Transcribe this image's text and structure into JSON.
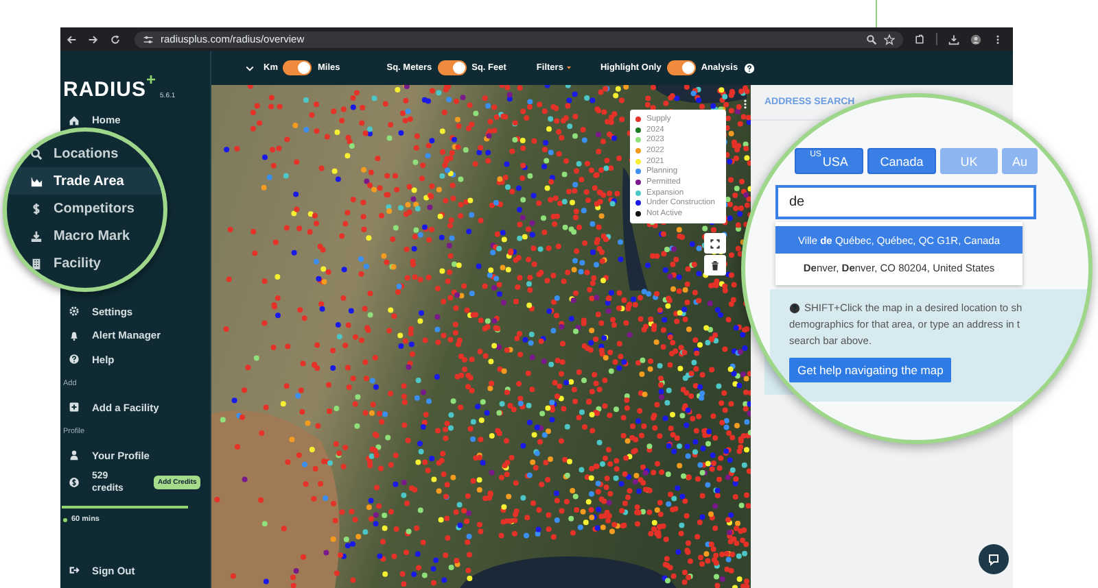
{
  "browser": {
    "url": "radiusplus.com/radius/overview"
  },
  "app": {
    "logo": "RADIUS",
    "logo_mark": "+",
    "version": "5.6.1"
  },
  "toolbar": {
    "units": [
      {
        "left": "Km",
        "right": "Miles",
        "on": true
      },
      {
        "left": "Sq. Meters",
        "right": "Sq. Feet",
        "on": true
      }
    ],
    "filters": "Filters",
    "highlight": {
      "left": "Highlight Only",
      "right": "Analysis",
      "on": true
    }
  },
  "sidebar": {
    "items": [
      {
        "kind": "link",
        "label": "Home"
      },
      {
        "kind": "link",
        "label": "Settings"
      },
      {
        "kind": "link",
        "label": "Alert Manager"
      },
      {
        "kind": "link",
        "label": "Help"
      },
      {
        "kind": "section",
        "label": "Add"
      },
      {
        "kind": "link",
        "label": "Add a Facility"
      },
      {
        "kind": "section",
        "label": "Profile"
      },
      {
        "kind": "link",
        "label": "Your Profile"
      },
      {
        "kind": "credits",
        "amount": "529",
        "unit": "credits",
        "button": "Add Credits"
      },
      {
        "kind": "timer",
        "level": 1,
        "label": "60 mins"
      }
    ],
    "sign_out": "Sign Out"
  },
  "sidebar_magnifier": {
    "items": [
      {
        "label": "Locations",
        "selected": false
      },
      {
        "label": "Trade Area",
        "selected": true
      },
      {
        "label": "Competitors",
        "selected": false
      },
      {
        "label": "Macro Mark",
        "selected": false
      },
      {
        "label": "Facility",
        "selected": false
      }
    ]
  },
  "map": {
    "legend": [
      {
        "label": "Supply",
        "color": "#e53228"
      },
      {
        "label": "2024",
        "color": "#1e7a1e"
      },
      {
        "label": "2023",
        "color": "#8fe07a"
      },
      {
        "label": "2022",
        "color": "#f39c1f"
      },
      {
        "label": "2021",
        "color": "#f5f032"
      },
      {
        "label": "Planning",
        "color": "#3b8ff0"
      },
      {
        "label": "Permitted",
        "color": "#7a1a8a"
      },
      {
        "label": "Expansion",
        "color": "#4cc6c6"
      },
      {
        "label": "Under Construction",
        "color": "#1a1ae6"
      },
      {
        "label": "Not Active",
        "color": "#111111"
      }
    ]
  },
  "panel": {
    "title": "ADDRESS SEARCH"
  },
  "search_magnifier": {
    "country_tabs": [
      {
        "label": "USA",
        "flag": "US",
        "disabled": false
      },
      {
        "label": "Canada",
        "disabled": false
      },
      {
        "label": "UK",
        "disabled": true
      },
      {
        "label": "Au",
        "disabled": true
      }
    ],
    "search": {
      "value": "de"
    },
    "suggestions": [
      {
        "text": "Ville **de** Québec, Québec, QC G1R, Canada",
        "selected": true
      },
      {
        "text": "**De**nver, **De**nver, CO 80204, United States",
        "selected": false
      }
    ],
    "help": {
      "lines": [
        "SHIFT+Click the map in a desired location to sh",
        "demographics for that area, or type an address in t",
        "search bar above."
      ],
      "button": "Get help navigating the map"
    }
  }
}
